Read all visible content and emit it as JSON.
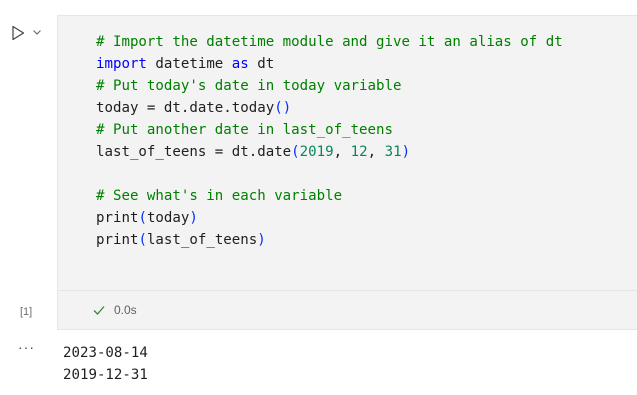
{
  "cell": {
    "execution_count": "[1]",
    "duration": "0.0s",
    "code_lines": [
      [
        {
          "t": "# Import the datetime module and give it an alias of dt",
          "c": "comment"
        }
      ],
      [
        {
          "t": "import",
          "c": "kw"
        },
        {
          "t": " datetime ",
          "c": ""
        },
        {
          "t": "as",
          "c": "kw"
        },
        {
          "t": " dt",
          "c": ""
        }
      ],
      [
        {
          "t": "# Put today's date in today variable",
          "c": "comment"
        }
      ],
      [
        {
          "t": "today = dt.date.today",
          "c": ""
        },
        {
          "t": "()",
          "c": "paren"
        }
      ],
      [
        {
          "t": "# Put another date in last_of_teens",
          "c": "comment"
        }
      ],
      [
        {
          "t": "last_of_teens = dt.date",
          "c": ""
        },
        {
          "t": "(",
          "c": "paren"
        },
        {
          "t": "2019",
          "c": "num"
        },
        {
          "t": ", ",
          "c": ""
        },
        {
          "t": "12",
          "c": "num"
        },
        {
          "t": ", ",
          "c": ""
        },
        {
          "t": "31",
          "c": "num"
        },
        {
          "t": ")",
          "c": "paren"
        }
      ],
      [
        {
          "t": "",
          "c": ""
        }
      ],
      [
        {
          "t": "# See what's in each variable",
          "c": "comment"
        }
      ],
      [
        {
          "t": "print",
          "c": ""
        },
        {
          "t": "(",
          "c": "paren"
        },
        {
          "t": "today",
          "c": ""
        },
        {
          "t": ")",
          "c": "paren"
        }
      ],
      [
        {
          "t": "print",
          "c": ""
        },
        {
          "t": "(",
          "c": "paren"
        },
        {
          "t": "last_of_teens",
          "c": ""
        },
        {
          "t": ")",
          "c": "paren"
        }
      ]
    ]
  },
  "output": {
    "toggle_label": "···",
    "lines": [
      "2023-08-14",
      "2019-12-31"
    ]
  },
  "colors": {
    "comment": "#008000",
    "keyword": "#0000ff",
    "number": "#098658",
    "success": "#388a34",
    "cell_background": "#f3f3f3"
  },
  "icons": {
    "run": "play-outline-icon",
    "run_menu": "chevron-down-icon",
    "status": "check-icon"
  }
}
